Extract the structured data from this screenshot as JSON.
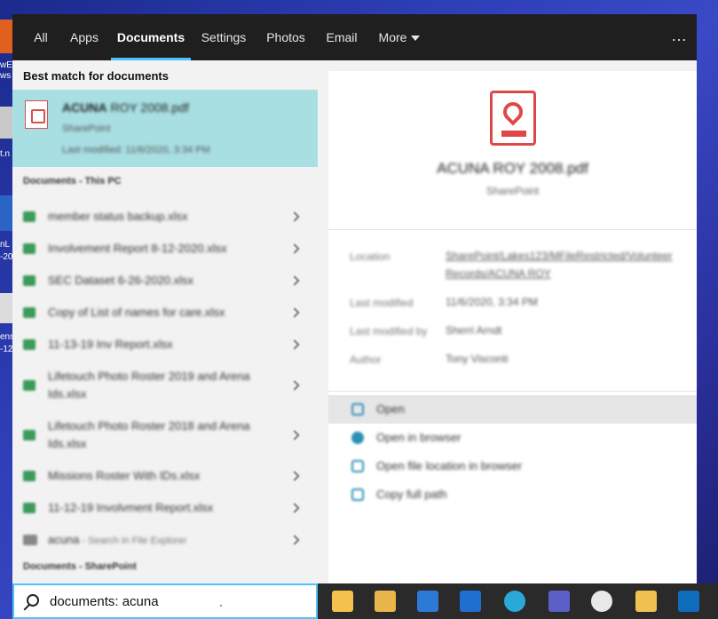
{
  "tabs": [
    {
      "label": "All"
    },
    {
      "label": "Apps"
    },
    {
      "label": "Documents"
    },
    {
      "label": "Settings"
    },
    {
      "label": "Photos"
    },
    {
      "label": "Email"
    },
    {
      "label": "More"
    }
  ],
  "more_menu": "…",
  "left": {
    "heading": "Best match for documents",
    "best": {
      "title_bold": "ACUNA",
      "title_rest": " ROY 2008.pdf",
      "source": "SharePoint",
      "modified": "Last modified: 11/6/2020, 3:34 PM"
    },
    "section_pc": "Documents - This PC",
    "items": [
      {
        "label": "member status backup.xlsx"
      },
      {
        "label": "Involvement Report 8-12-2020.xlsx"
      },
      {
        "label": "SEC Dataset 6-26-2020.xlsx"
      },
      {
        "label": "Copy of List of names for care.xlsx"
      },
      {
        "label": "11-13-19 Inv Report.xlsx"
      },
      {
        "label": "Lifetouch Photo Roster 2019 and Arena Ids.xlsx"
      },
      {
        "label": "Lifetouch Photo Roster 2018 and Arena Ids.xlsx"
      },
      {
        "label": "Missions Roster With IDs.xlsx"
      },
      {
        "label": "11-12-19 Involvment Report.xlsx"
      }
    ],
    "folder_item": {
      "label": "acuna",
      "hint": " - Search in File Explorer"
    },
    "section_sp": "Documents - SharePoint"
  },
  "preview": {
    "title": "ACUNA ROY 2008.pdf",
    "source": "SharePoint",
    "props": {
      "location_label": "Location",
      "location_value": "SharePoint/Lakes123/MFileRestricted/Volunteer Records/ACUNA ROY",
      "modified_label": "Last modified",
      "modified_value": "11/6/2020, 3:34 PM",
      "modified_by_label": "Last modified by",
      "modified_by_value": "Sherri Arndt",
      "author_label": "Author",
      "author_value": "Tony Visconti"
    },
    "actions": {
      "open": "Open",
      "open_browser": "Open in browser",
      "open_location": "Open file location in browser",
      "copy_path": "Copy full path"
    }
  },
  "search": {
    "value": "documents: acuna"
  },
  "desktop_fragments": [
    "wE",
    "ws",
    "t.n",
    "nL",
    "-20",
    "ens",
    "-12"
  ]
}
